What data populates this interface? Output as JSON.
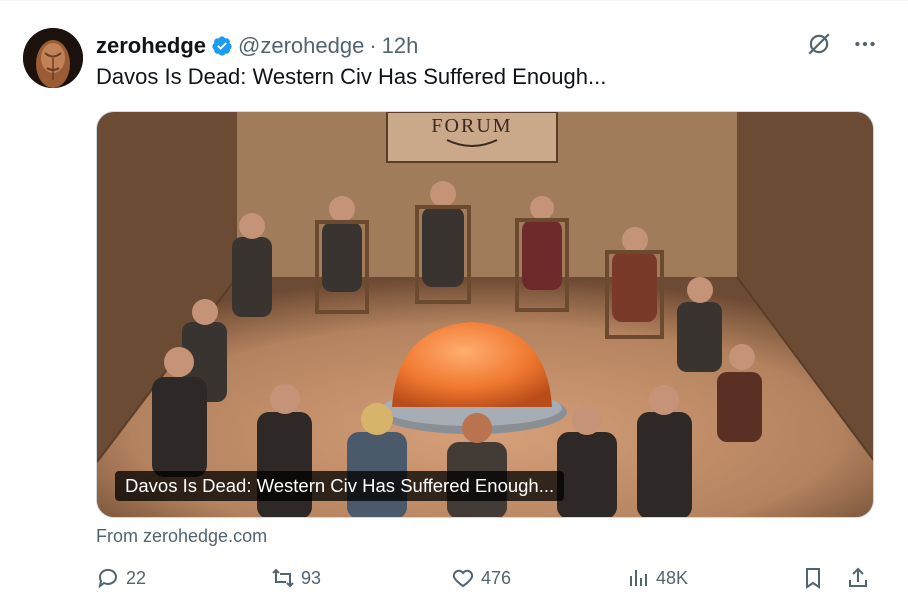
{
  "tweet": {
    "author_name": "zerohedge",
    "handle": "@zerohedge",
    "separator": "·",
    "time": "12h",
    "text": "Davos Is Dead: Western Civ Has Suffered Enough...",
    "icons": [
      "verified-badge-icon",
      "grok-icon",
      "more-icon"
    ]
  },
  "card": {
    "image_sign_text": "FORUM",
    "caption": "Davos Is Dead: Western Civ Has Suffered Enough...",
    "source": "From zerohedge.com"
  },
  "actions": {
    "replies": "22",
    "reposts": "93",
    "likes": "476",
    "views": "48K"
  },
  "colors": {
    "text_primary": "#0f1419",
    "text_secondary": "#536471",
    "verified_blue": "#1d9bf0"
  }
}
